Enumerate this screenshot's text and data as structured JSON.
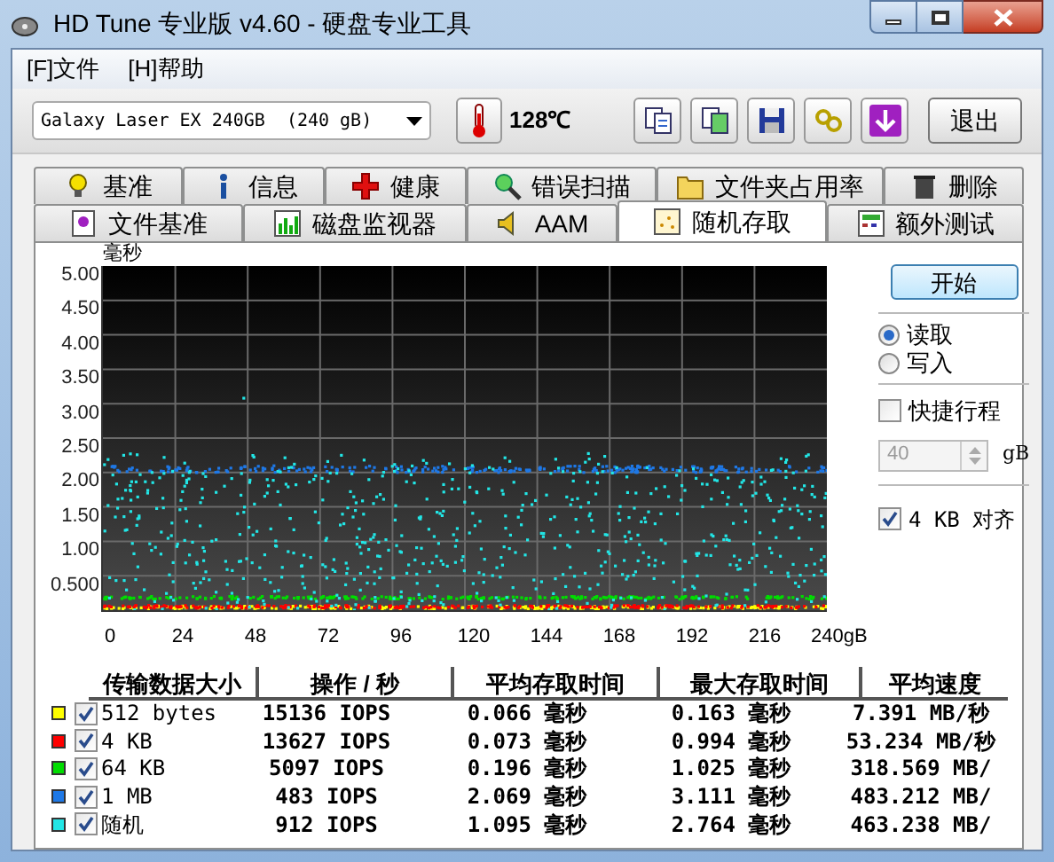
{
  "window": {
    "title": "HD Tune 专业版 v4.60 - 硬盘专业工具"
  },
  "menu": [
    "[F]文件",
    "[H]帮助"
  ],
  "toolbar": {
    "drive": "Galaxy Laser EX 240GB",
    "drive_size": "(240 gB)",
    "temperature": "128℃",
    "exit": "退出"
  },
  "tabs_row1": [
    {
      "label": "基准",
      "selected": false
    },
    {
      "label": "信息",
      "selected": false
    },
    {
      "label": "健康",
      "selected": false
    },
    {
      "label": "错误扫描",
      "selected": false
    },
    {
      "label": "文件夹占用率",
      "selected": false
    },
    {
      "label": "删除",
      "selected": false
    }
  ],
  "tabs_row2": [
    {
      "label": "文件基准",
      "selected": false
    },
    {
      "label": "磁盘监视器",
      "selected": false
    },
    {
      "label": "AAM",
      "selected": false
    },
    {
      "label": "随机存取",
      "selected": true
    },
    {
      "label": "额外测试",
      "selected": false
    }
  ],
  "chart": {
    "y_unit": "毫秒",
    "y_ticks": [
      "5.00",
      "4.50",
      "4.00",
      "3.50",
      "3.00",
      "2.50",
      "2.00",
      "1.50",
      "1.00",
      "0.500"
    ],
    "x_ticks": [
      "0",
      "24",
      "48",
      "72",
      "96",
      "120",
      "144",
      "168",
      "192",
      "216",
      "240gB"
    ]
  },
  "controls": {
    "start": "开始",
    "modes": [
      {
        "label": "读取",
        "selected": true
      },
      {
        "label": "写入",
        "selected": false
      }
    ],
    "quick": {
      "label": "快捷行程",
      "checked": false
    },
    "quick_size": {
      "value": "40",
      "unit": "gB",
      "disabled": true
    },
    "align": {
      "label": "4 KB 对齐",
      "checked": true
    }
  },
  "table": {
    "columns": [
      "传输数据大小",
      "操作 / 秒",
      "平均存取时间",
      "最大存取时间",
      "平均速度"
    ],
    "rows": [
      {
        "color": "#ffff00",
        "checked": true,
        "size": "512 bytes",
        "ops": "15136 IOPS",
        "avg": "0.066 毫秒",
        "max": "0.163 毫秒",
        "speed": "7.391 MB/秒"
      },
      {
        "color": "#ff0000",
        "checked": true,
        "size": "4 KB",
        "ops": "13627 IOPS",
        "avg": "0.073 毫秒",
        "max": "0.994 毫秒",
        "speed": "53.234 MB/秒"
      },
      {
        "color": "#00dd00",
        "checked": true,
        "size": "64 KB",
        "ops": "5097 IOPS",
        "avg": "0.196 毫秒",
        "max": "1.025 毫秒",
        "speed": "318.569 MB/"
      },
      {
        "color": "#1e78e6",
        "checked": true,
        "size": "1 MB",
        "ops": "483 IOPS",
        "avg": "2.069 毫秒",
        "max": "3.111 毫秒",
        "speed": "483.212 MB/"
      },
      {
        "color": "#22e6e6",
        "checked": true,
        "size": "随机",
        "ops": "912 IOPS",
        "avg": "1.095 毫秒",
        "max": "2.764 毫秒",
        "speed": "463.238 MB/"
      }
    ]
  }
}
